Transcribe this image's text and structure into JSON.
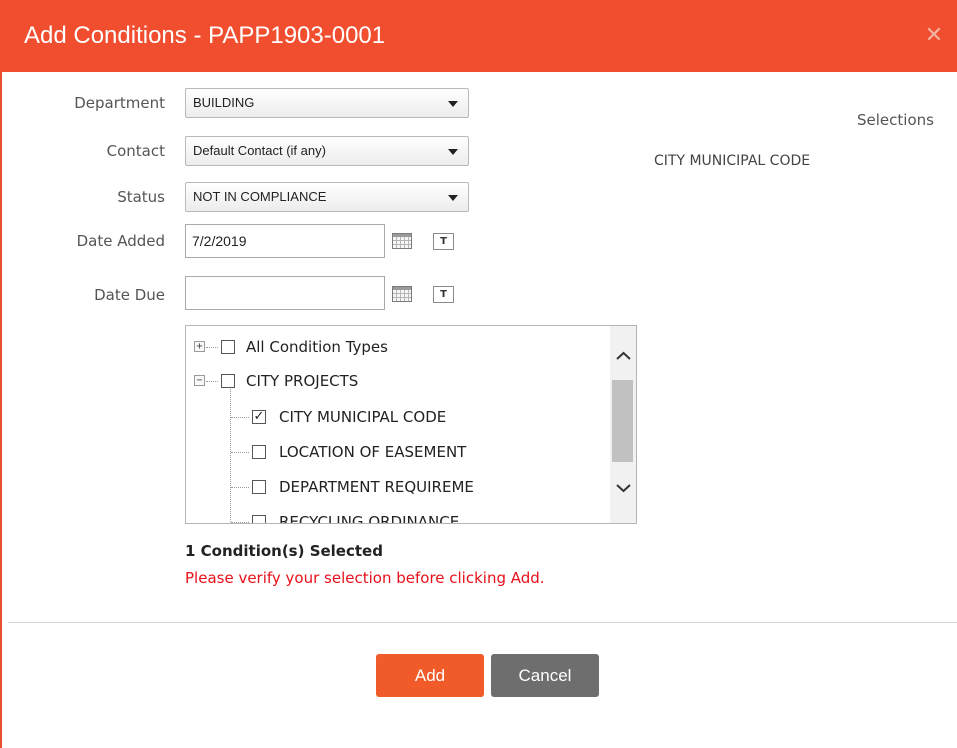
{
  "dialog": {
    "title": "Add Conditions - PAPP1903-0001",
    "close_glyph": "✕",
    "accent_color": "#f04e2f"
  },
  "form": {
    "department": {
      "label": "Department",
      "value": "BUILDING"
    },
    "contact": {
      "label": "Contact",
      "value": "Default Contact (if any)"
    },
    "status": {
      "label": "Status",
      "value": "NOT IN COMPLIANCE"
    },
    "date_added": {
      "label": "Date Added",
      "value": "7/2/2019",
      "today_glyph": "T"
    },
    "date_due": {
      "label": "Date Due",
      "value": "",
      "today_glyph": "T"
    }
  },
  "tree": {
    "items": [
      {
        "label": "All Condition Types",
        "checked": false,
        "expander": "+"
      },
      {
        "label": "CITY PROJECTS",
        "checked": false,
        "expander": "−"
      },
      {
        "label": "CITY MUNICIPAL CODE",
        "checked": true
      },
      {
        "label": "LOCATION OF EASEMENT",
        "checked": false
      },
      {
        "label": "DEPARTMENT REQUIREME",
        "checked": false
      },
      {
        "label": "RECYCLING ORDINANCE",
        "checked": false
      }
    ],
    "check_glyph": "✓"
  },
  "summary": {
    "count_text": "1 Condition(s) Selected",
    "warning_text": "Please verify your selection before clicking Add.",
    "warning_color": "#e8101a"
  },
  "selections": {
    "heading": "Selections",
    "items": [
      "CITY MUNICIPAL CODE"
    ]
  },
  "footer": {
    "add_label": "Add",
    "cancel_label": "Cancel"
  }
}
